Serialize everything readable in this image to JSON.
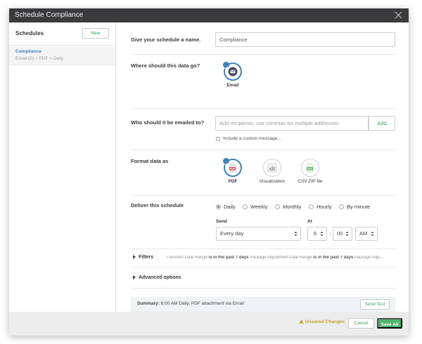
{
  "window": {
    "title": "Schedule Compliance"
  },
  "sidebar": {
    "heading": "Schedules",
    "new_label": "New",
    "items": [
      {
        "name": "Compliance",
        "detail": "Email (0) > PDF > Daily"
      }
    ]
  },
  "name_section": {
    "label": "Give your schedule a name.",
    "value": "Compliance"
  },
  "destination": {
    "label": "Where should this data go?",
    "options": [
      {
        "label": "Email",
        "icon": "email-icon",
        "selected": true
      }
    ]
  },
  "recipients": {
    "label": "Who should it be emailed to?",
    "placeholder": "Add recipients, use commas for multiple addresses",
    "add_label": "Add",
    "custom_message_label": "Include a custom message..."
  },
  "format": {
    "label": "Format data as",
    "options": [
      {
        "label": "PDF",
        "icon": "pdf-icon",
        "selected": true
      },
      {
        "label": "Visualization",
        "icon": "visualization-icon",
        "selected": false
      },
      {
        "label": "CSV ZIP file",
        "icon": "csv-zip-icon",
        "selected": false
      }
    ]
  },
  "delivery": {
    "label": "Deliver this schedule",
    "frequencies": [
      {
        "label": "Daily",
        "selected": true
      },
      {
        "label": "Weekly",
        "selected": false
      },
      {
        "label": "Monthly",
        "selected": false
      },
      {
        "label": "Hourly",
        "selected": false
      },
      {
        "label": "By minute",
        "selected": false
      }
    ],
    "send_label": "Send",
    "send_value": "Every day",
    "at_label": "At",
    "hour": "6",
    "minute": "00",
    "ampm": "AM"
  },
  "filters": {
    "label": "Filters",
    "f1_name": "Transfers Date Range",
    "f1_cond": "is in the past 7 days",
    "f2_name": "Package Adjustment Date Range",
    "f2_cond": "is in the past 7 days",
    "f3_name": "Package Adju..."
  },
  "advanced": {
    "label": "Advanced options"
  },
  "summary": {
    "label": "Summary:",
    "text": "6:00 AM Daily, PDF attachment via Email",
    "send_test_label": "Send Test"
  },
  "footer": {
    "unsaved_label": "Unsaved Changes",
    "cancel_label": "Cancel",
    "save_label": "Save All"
  },
  "colors": {
    "accent_blue": "#3b82c4",
    "accent_green": "#3aa55f",
    "save_green": "#4fb36a",
    "warning": "#c9a227",
    "titlebar": "#3b3b3d"
  }
}
